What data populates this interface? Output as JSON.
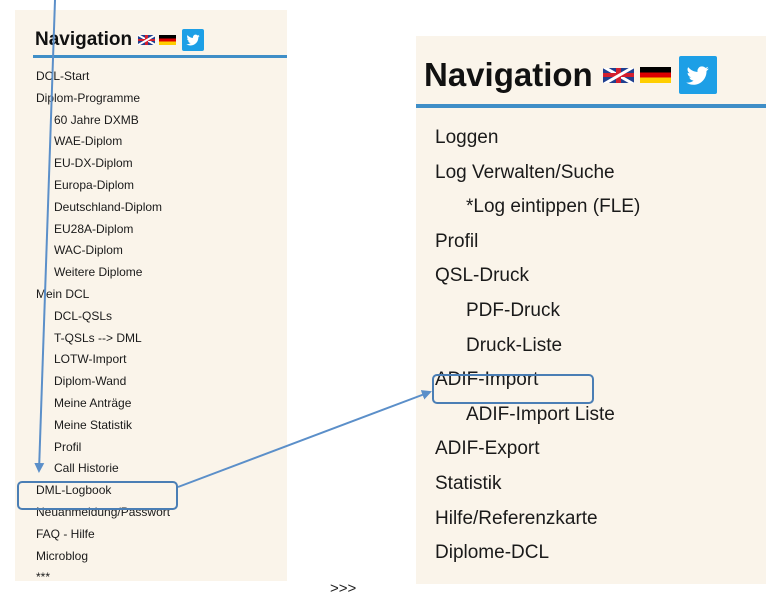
{
  "left_nav": {
    "title": "Navigation",
    "items": [
      {
        "label": "DCL-Start",
        "level": 0
      },
      {
        "label": "Diplom-Programme",
        "level": 0
      },
      {
        "label": "60 Jahre DXMB",
        "level": 1
      },
      {
        "label": "WAE-Diplom",
        "level": 1
      },
      {
        "label": "EU-DX-Diplom",
        "level": 1
      },
      {
        "label": "Europa-Diplom",
        "level": 1
      },
      {
        "label": "Deutschland-Diplom",
        "level": 1
      },
      {
        "label": "EU28A-Diplom",
        "level": 1
      },
      {
        "label": "WAC-Diplom",
        "level": 1
      },
      {
        "label": "Weitere Diplome",
        "level": 1
      },
      {
        "label": "Mein DCL",
        "level": 0
      },
      {
        "label": "DCL-QSLs",
        "level": 1
      },
      {
        "label": "T-QSLs --> DML",
        "level": 1
      },
      {
        "label": "LOTW-Import",
        "level": 1
      },
      {
        "label": "Diplom-Wand",
        "level": 1
      },
      {
        "label": "Meine Anträge",
        "level": 1
      },
      {
        "label": "Meine Statistik",
        "level": 1
      },
      {
        "label": "Profil",
        "level": 1
      },
      {
        "label": "Call Historie",
        "level": 1
      },
      {
        "label": "DML-Logbook",
        "level": 0
      },
      {
        "label": "Neuanmeldung/Passwort",
        "level": 0
      },
      {
        "label": "FAQ - Hilfe",
        "level": 0
      },
      {
        "label": "Microblog",
        "level": 0
      },
      {
        "label": "***",
        "level": 0
      }
    ]
  },
  "right_nav": {
    "title": "Navigation",
    "items": [
      {
        "label": "Loggen",
        "level": 0
      },
      {
        "label": "Log Verwalten/Suche",
        "level": 0
      },
      {
        "label": "*Log eintippen (FLE)",
        "level": 1
      },
      {
        "label": "Profil",
        "level": 0
      },
      {
        "label": "QSL-Druck",
        "level": 0
      },
      {
        "label": "PDF-Druck",
        "level": 1
      },
      {
        "label": "Druck-Liste",
        "level": 1
      },
      {
        "label": "ADIF-Import",
        "level": 0
      },
      {
        "label": "ADIF-Import Liste",
        "level": 1
      },
      {
        "label": "ADIF-Export",
        "level": 0
      },
      {
        "label": "Statistik",
        "level": 0
      },
      {
        "label": "Hilfe/Referenzkarte",
        "level": 0
      },
      {
        "label": "Diplome-DCL",
        "level": 0
      }
    ]
  },
  "separator_text": ">>>",
  "highlighted": {
    "left": "DML-Logbook",
    "right": "ADIF-Import"
  },
  "icons": {
    "flag_english": "uk-flag-icon",
    "flag_german": "germany-flag-icon",
    "twitter": "twitter-bird-icon"
  },
  "colors": {
    "panel_background": "#faf4ea",
    "header_rule": "#3f8ec7",
    "highlight_border": "#4a7eb5",
    "arrow": "#5b8fc9",
    "twitter_blue": "#1d9fe6"
  }
}
